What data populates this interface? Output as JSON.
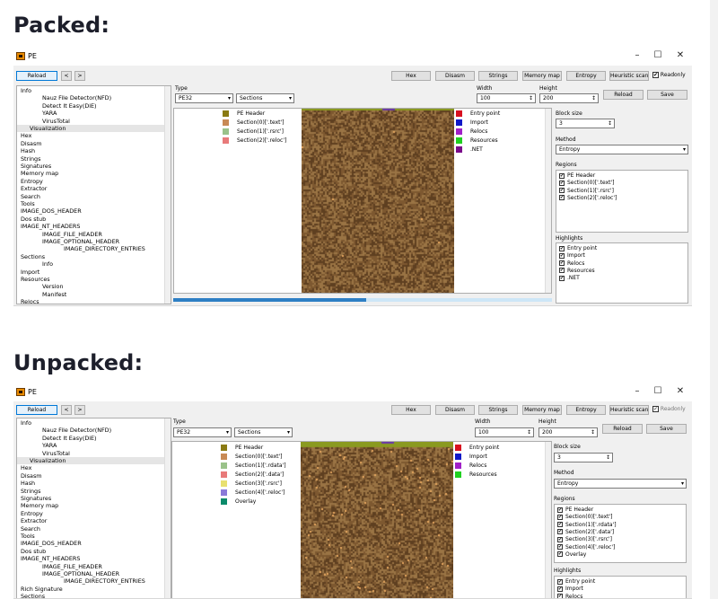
{
  "sections": {
    "packed_heading": "Packed:",
    "unpacked_heading": "Unpacked:"
  },
  "window": {
    "title": "PE",
    "minimize": "–",
    "maximize": "☐",
    "close": "✕"
  },
  "toolbar": {
    "reload": "Reload",
    "back": "<",
    "forward": ">",
    "hex": "Hex",
    "disasm": "Disasm",
    "strings": "Strings",
    "memory_map": "Memory map",
    "entropy": "Entropy",
    "heuristic_scan": "Heuristic scan",
    "readonly": "Readonly",
    "check": "✔"
  },
  "tree_packed": [
    "Info",
    "Nauz File Detector(NFD)",
    "Detect It Easy(DiE)",
    "YARA",
    "VirusTotal",
    "Visualization",
    "Hex",
    "Disasm",
    "Hash",
    "Strings",
    "Signatures",
    "Memory map",
    "Entropy",
    "Extractor",
    "Search",
    "Tools",
    "IMAGE_DOS_HEADER",
    "Dos stub",
    "IMAGE_NT_HEADERS",
    "IMAGE_FILE_HEADER",
    "IMAGE_OPTIONAL_HEADER",
    "IMAGE_DIRECTORY_ENTRIES",
    "Sections",
    "Info",
    "Import",
    "Resources",
    "Version",
    "Manifest",
    "Relocs"
  ],
  "tree_unpacked": [
    "Info",
    "Nauz File Detector(NFD)",
    "Detect It Easy(DiE)",
    "YARA",
    "VirusTotal",
    "Visualization",
    "Hex",
    "Disasm",
    "Hash",
    "Strings",
    "Signatures",
    "Memory map",
    "Entropy",
    "Extractor",
    "Search",
    "Tools",
    "IMAGE_DOS_HEADER",
    "Dos stub",
    "IMAGE_NT_HEADERS",
    "IMAGE_FILE_HEADER",
    "IMAGE_OPTIONAL_HEADER",
    "IMAGE_DIRECTORY_ENTRIES",
    "Rich Signature",
    "Sections"
  ],
  "controls": {
    "type_label": "Type",
    "type_value": "PE32",
    "view_value": "Sections",
    "width_label": "Width",
    "width_value": "100",
    "height_label": "Height",
    "height_value": "200",
    "reload": "Reload",
    "save": "Save",
    "block_size_label": "Block size",
    "block_size_value": "3",
    "method_label": "Method",
    "method_value": "Entropy",
    "regions_label": "Regions",
    "highlights_label": "Highlights"
  },
  "legend_packed": [
    {
      "label": "PE Header",
      "color": "#8a7a12"
    },
    {
      "label": "Section(0)['.text']",
      "color": "#c88a55"
    },
    {
      "label": "Section(1)['.rsrc']",
      "color": "#9ac28a"
    },
    {
      "label": "Section(2)['.reloc']",
      "color": "#e87a7a"
    }
  ],
  "legend_unpacked": [
    {
      "label": "PE Header",
      "color": "#8a7a12"
    },
    {
      "label": "Section(0)['.text']",
      "color": "#c88a55"
    },
    {
      "label": "Section(1)['.rdata']",
      "color": "#9ac28a"
    },
    {
      "label": "Section(2)['.data']",
      "color": "#e87a7a"
    },
    {
      "label": "Section(3)['.rsrc']",
      "color": "#e8e070"
    },
    {
      "label": "Section(4)['.reloc']",
      "color": "#8a7ad8"
    },
    {
      "label": "Overlay",
      "color": "#0a8a6a"
    }
  ],
  "highlight_legend": [
    {
      "label": "Entry point",
      "color": "#d81020"
    },
    {
      "label": "Import",
      "color": "#1018c8"
    },
    {
      "label": "Relocs",
      "color": "#a020c8"
    },
    {
      "label": "Resources",
      "color": "#20d020"
    },
    {
      "label": ".NET",
      "color": "#7a0a8a"
    }
  ],
  "highlight_legend_unpacked": [
    {
      "label": "Entry point",
      "color": "#d81020"
    },
    {
      "label": "Import",
      "color": "#1018c8"
    },
    {
      "label": "Relocs",
      "color": "#a020c8"
    },
    {
      "label": "Resources",
      "color": "#20d020"
    }
  ],
  "regions_packed": [
    "PE Header",
    "Section(0)['.text']",
    "Section(1)['.rsrc']",
    "Section(2)['.reloc']"
  ],
  "regions_unpacked": [
    "PE Header",
    "Section(0)['.text']",
    "Section(1)['.rdata']",
    "Section(2)['.data']",
    "Section(3)['.rsrc']",
    "Section(4)['.reloc']",
    "Overlay"
  ],
  "highlights_packed": [
    "Entry point",
    "Import",
    "Relocs",
    "Resources",
    ".NET"
  ],
  "highlights_unpacked": [
    "Entry point",
    "Import",
    "Relocs"
  ],
  "entropy_colors": {
    "base": "#7d5830",
    "light": "#9a7444",
    "dark": "#5e3f20",
    "speck": "#e8a860",
    "header": "#8a9a20"
  },
  "packed_hscroll_fraction": 0.51
}
